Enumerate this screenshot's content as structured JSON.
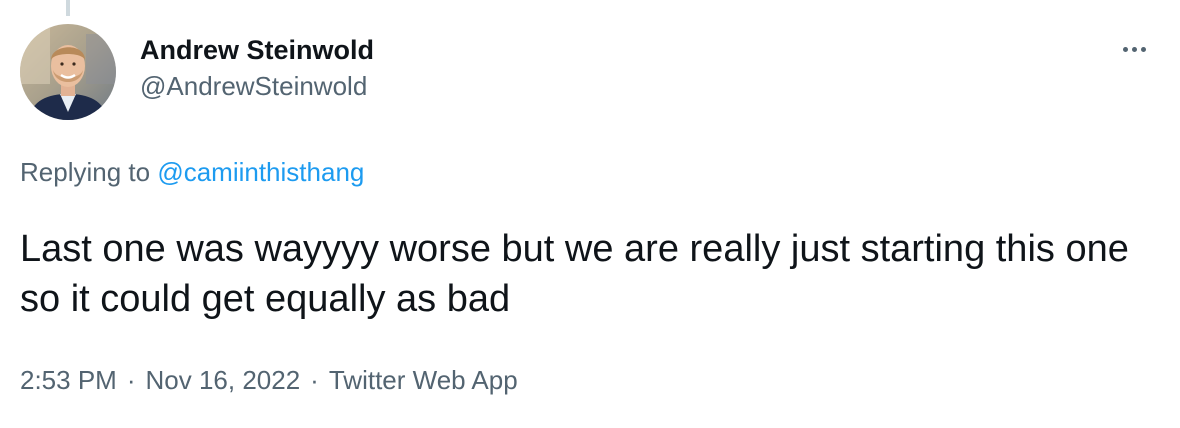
{
  "tweet": {
    "author": {
      "display_name": "Andrew Steinwold",
      "handle": "@AndrewSteinwold"
    },
    "replying_prefix": "Replying to",
    "replying_to": "@camiinthisthang",
    "text": "Last one was wayyyy worse but we are really just starting this one so it could get equally as bad",
    "time": "2:53 PM",
    "date": "Nov 16, 2022",
    "source": "Twitter Web App",
    "separator": "·"
  },
  "icons": {
    "more": "more-horizontal-icon",
    "avatar": "profile-photo"
  },
  "colors": {
    "text": "#0f1419",
    "secondary": "#536471",
    "link": "#1d9bf0",
    "thread_line": "#cfd9de"
  }
}
